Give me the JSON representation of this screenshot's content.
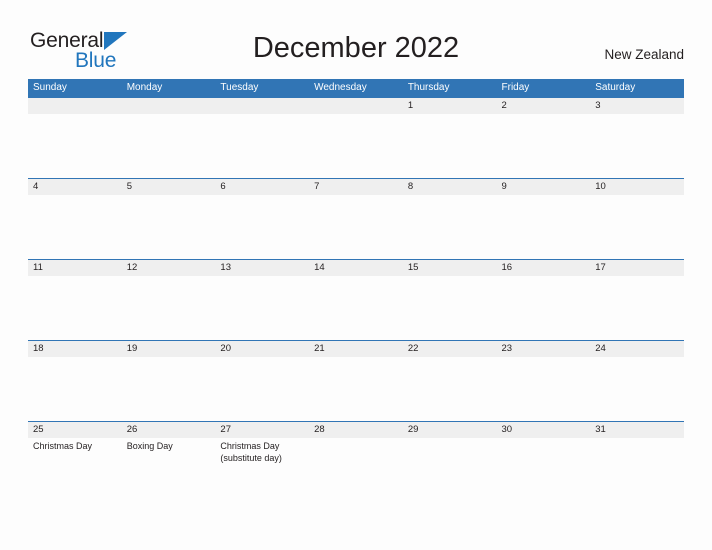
{
  "brand": {
    "name_part1": "General",
    "name_part2": "Blue",
    "accent_color": "#2176bd",
    "text_color": "#231f20"
  },
  "header": {
    "title": "December 2022",
    "region": "New Zealand"
  },
  "calendar": {
    "header_bg": "#3175b5",
    "date_band_bg": "#efefef",
    "grid_line_color": "#3175b5",
    "weekdays": [
      "Sunday",
      "Monday",
      "Tuesday",
      "Wednesday",
      "Thursday",
      "Friday",
      "Saturday"
    ],
    "weeks": [
      [
        {
          "date": "",
          "event": ""
        },
        {
          "date": "",
          "event": ""
        },
        {
          "date": "",
          "event": ""
        },
        {
          "date": "",
          "event": ""
        },
        {
          "date": "1",
          "event": ""
        },
        {
          "date": "2",
          "event": ""
        },
        {
          "date": "3",
          "event": ""
        }
      ],
      [
        {
          "date": "4",
          "event": ""
        },
        {
          "date": "5",
          "event": ""
        },
        {
          "date": "6",
          "event": ""
        },
        {
          "date": "7",
          "event": ""
        },
        {
          "date": "8",
          "event": ""
        },
        {
          "date": "9",
          "event": ""
        },
        {
          "date": "10",
          "event": ""
        }
      ],
      [
        {
          "date": "11",
          "event": ""
        },
        {
          "date": "12",
          "event": ""
        },
        {
          "date": "13",
          "event": ""
        },
        {
          "date": "14",
          "event": ""
        },
        {
          "date": "15",
          "event": ""
        },
        {
          "date": "16",
          "event": ""
        },
        {
          "date": "17",
          "event": ""
        }
      ],
      [
        {
          "date": "18",
          "event": ""
        },
        {
          "date": "19",
          "event": ""
        },
        {
          "date": "20",
          "event": ""
        },
        {
          "date": "21",
          "event": ""
        },
        {
          "date": "22",
          "event": ""
        },
        {
          "date": "23",
          "event": ""
        },
        {
          "date": "24",
          "event": ""
        }
      ],
      [
        {
          "date": "25",
          "event": "Christmas Day"
        },
        {
          "date": "26",
          "event": "Boxing Day"
        },
        {
          "date": "27",
          "event": "Christmas Day\n(substitute day)"
        },
        {
          "date": "28",
          "event": ""
        },
        {
          "date": "29",
          "event": ""
        },
        {
          "date": "30",
          "event": ""
        },
        {
          "date": "31",
          "event": ""
        }
      ]
    ]
  }
}
